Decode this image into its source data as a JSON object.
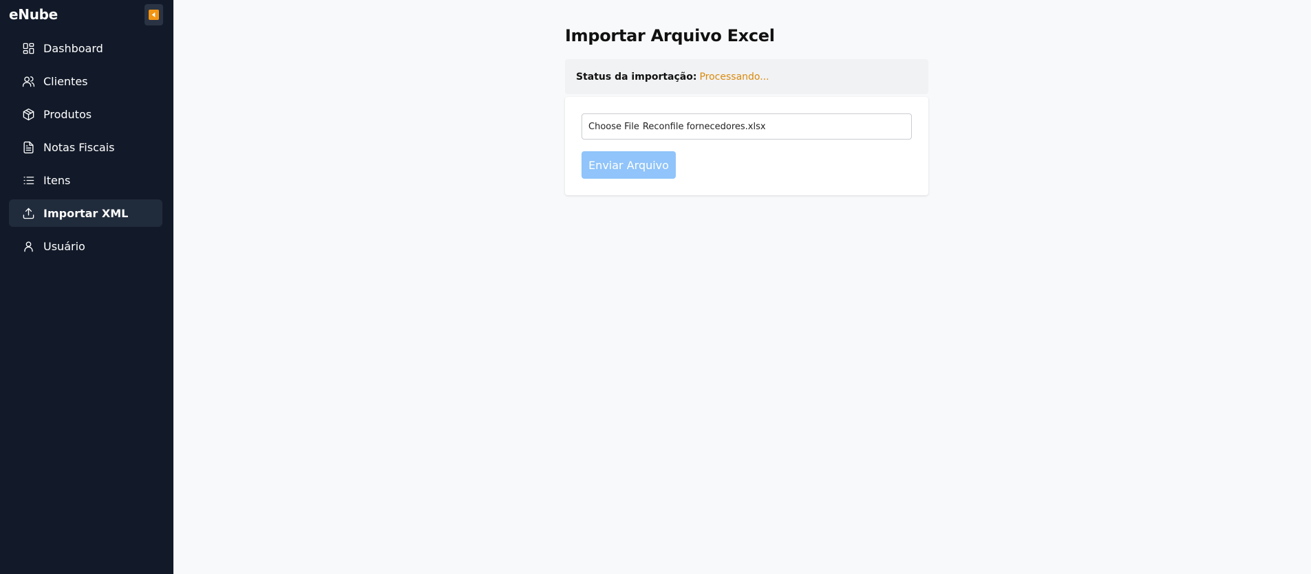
{
  "sidebar": {
    "brand": "eNube",
    "collapse_icon": "caret-left-icon",
    "items": [
      {
        "label": "Dashboard",
        "icon": "grid-icon",
        "active": false
      },
      {
        "label": "Clientes",
        "icon": "users-icon",
        "active": false
      },
      {
        "label": "Produtos",
        "icon": "package-icon",
        "active": false
      },
      {
        "label": "Notas Fiscais",
        "icon": "document-icon",
        "active": false
      },
      {
        "label": "Itens",
        "icon": "list-icon",
        "active": false
      },
      {
        "label": "Importar XML",
        "icon": "upload-icon",
        "active": true
      },
      {
        "label": "Usuário",
        "icon": "user-icon",
        "active": false
      }
    ]
  },
  "main": {
    "title": "Importar Arquivo Excel",
    "status": {
      "label": "Status da importação:",
      "value": "Processando..."
    },
    "file_input": {
      "button_label": "Choose File",
      "file_name": "Reconfile fornecedores.xlsx"
    },
    "submit_label": "Enviar Arquivo"
  },
  "colors": {
    "sidebar_bg": "#121a29",
    "active_item_bg": "#202b3b",
    "accent_orange": "#f29513",
    "status_processing": "#d98a0b",
    "button_disabled_blue": "#90c4fa"
  }
}
